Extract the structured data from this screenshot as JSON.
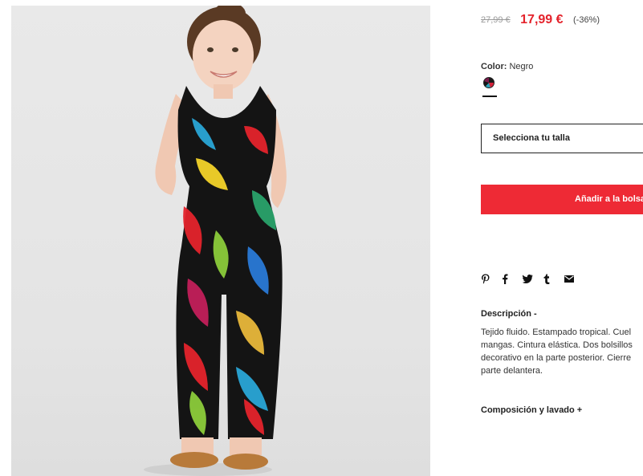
{
  "product": {
    "image_alt": "Girl wearing tropical print jumpsuit",
    "price": {
      "old": "27,99 €",
      "current": "17,99 €",
      "discount": "(-36%)"
    },
    "color": {
      "label": "Color:",
      "value": "Negro"
    },
    "size_select": {
      "placeholder": "Selecciona tu talla"
    },
    "add_to_bag_label": "Añadir a la bolsa",
    "share_icons": [
      "pinterest-icon",
      "facebook-icon",
      "twitter-icon",
      "tumblr-icon",
      "mail-icon"
    ],
    "share_glyphs": [
      "P",
      "f",
      "t",
      "t",
      "✉"
    ],
    "description": {
      "title": "Descripción -",
      "lines": [
        "Tejido fluido. Estampado tropical. Cuel",
        "mangas. Cintura elástica. Dos bolsillos",
        "decorativo en la parte posterior. Cierre",
        "parte delantera."
      ]
    },
    "composition_title": "Composición y lavado +"
  },
  "colors": {
    "sale_red": "#e4232c",
    "button_red": "#ee2a35",
    "text_dark": "#222222",
    "old_price_gray": "#9a9a9a"
  }
}
